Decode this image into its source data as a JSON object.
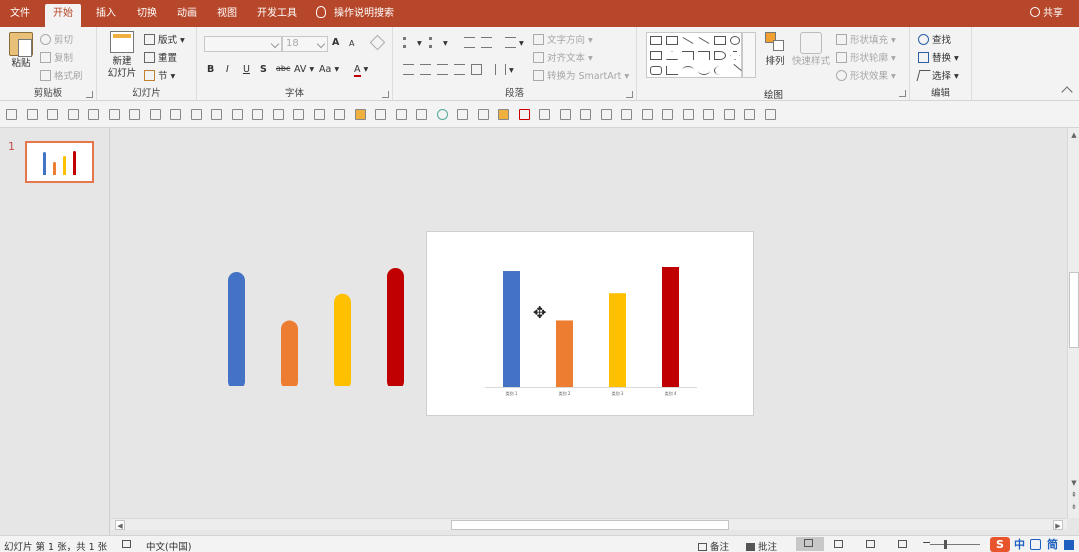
{
  "tabs": [
    "文件",
    "开始",
    "插入",
    "切换",
    "动画",
    "视图",
    "开发工具"
  ],
  "active_tab": "开始",
  "tell_me": "操作说明搜索",
  "share": "共享",
  "clipboard": {
    "paste": "粘贴",
    "cut": "剪切",
    "copy": "复制",
    "format_painter": "格式刷",
    "label": "剪贴板"
  },
  "slides_group": {
    "new_slide_line1": "新建",
    "new_slide_line2": "幻灯片",
    "layout": "版式",
    "reset": "重置",
    "section": "节",
    "label": "幻灯片"
  },
  "font": {
    "size": "18",
    "bold": "B",
    "italic": "I",
    "underline": "U",
    "shadow": "S",
    "strike": "abc",
    "spacing": "AV",
    "case": "Aa",
    "color": "A",
    "grow": "A",
    "shrink": "A",
    "label": "字体"
  },
  "paragraph": {
    "text_direction": "文字方向",
    "align_text": "对齐文本",
    "smartart": "转换为 SmartArt",
    "label": "段落"
  },
  "drawing": {
    "arrange": "排列",
    "quick_styles": "快速样式",
    "fill": "形状填充",
    "outline": "形状轮廓",
    "effects": "形状效果",
    "label": "绘图"
  },
  "editing": {
    "find": "查找",
    "replace": "替换",
    "select": "选择",
    "label": "编辑"
  },
  "thumbnail": {
    "number": "1"
  },
  "canvas_bars": {
    "colors": [
      "#4472c4",
      "#ed7d31",
      "#ffc000",
      "#c00000"
    ],
    "values": [
      115,
      66,
      93,
      119
    ]
  },
  "chart_data": {
    "type": "bar",
    "categories": [
      "类别 1",
      "类别 2",
      "类别 3",
      "类别 4"
    ],
    "values": [
      115,
      66,
      93,
      119
    ],
    "colors": [
      "#4472c4",
      "#ed7d31",
      "#ffc000",
      "#c00000"
    ],
    "title": "",
    "xlabel": "",
    "ylabel": "",
    "grid": false
  },
  "status": {
    "slide_info": "幻灯片 第 1 张，共 1 张",
    "language": "中文(中国)",
    "notes": "备注",
    "comments": "批注",
    "zoom_minus": "−",
    "ime_logo": "S",
    "ime_cn": "中",
    "ime_simplified": "简"
  }
}
